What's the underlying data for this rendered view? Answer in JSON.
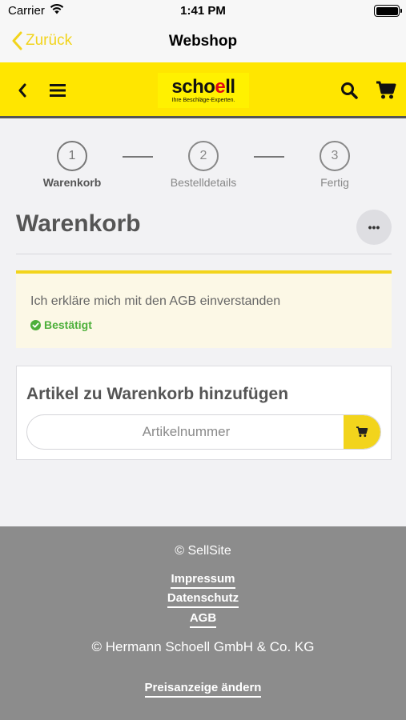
{
  "status_bar": {
    "carrier": "Carrier",
    "time": "1:41 PM",
    "battery_level": 1.0
  },
  "nav_bar": {
    "back_label": "Zurück",
    "title": "Webshop"
  },
  "shop_header": {
    "logo_text": "schoell",
    "logo_tagline": "Ihre Beschläge-Experten.",
    "icons": [
      "chevron-left-icon",
      "hamburger-menu-icon",
      "search-icon",
      "cart-icon"
    ],
    "background_color": "#ffe600"
  },
  "steps": [
    {
      "number": "1",
      "label": "Warenkorb",
      "active": true
    },
    {
      "number": "2",
      "label": "Bestelldetails",
      "active": false
    },
    {
      "number": "3",
      "label": "Fertig",
      "active": false
    }
  ],
  "page": {
    "title": "Warenkorb",
    "more_label": "•••"
  },
  "agb_notice": {
    "text": "Ich erkläre mich mit den AGB einverstanden",
    "status": "Bestätigt",
    "status_color": "#4caf3a"
  },
  "add_article": {
    "title": "Artikel zu Warenkorb hinzufügen",
    "placeholder": "Artikelnummer",
    "value": ""
  },
  "footer": {
    "sellsite": "© SellSite",
    "links": [
      "Impressum",
      "Datenschutz",
      "AGB"
    ],
    "company": "© Hermann Schoell GmbH & Co. KG",
    "price_display": "Preisanzeige ändern"
  },
  "colors": {
    "accent": "#f2d41c",
    "footer_bg": "#8c8c8c",
    "page_bg": "#f2f2f4"
  }
}
